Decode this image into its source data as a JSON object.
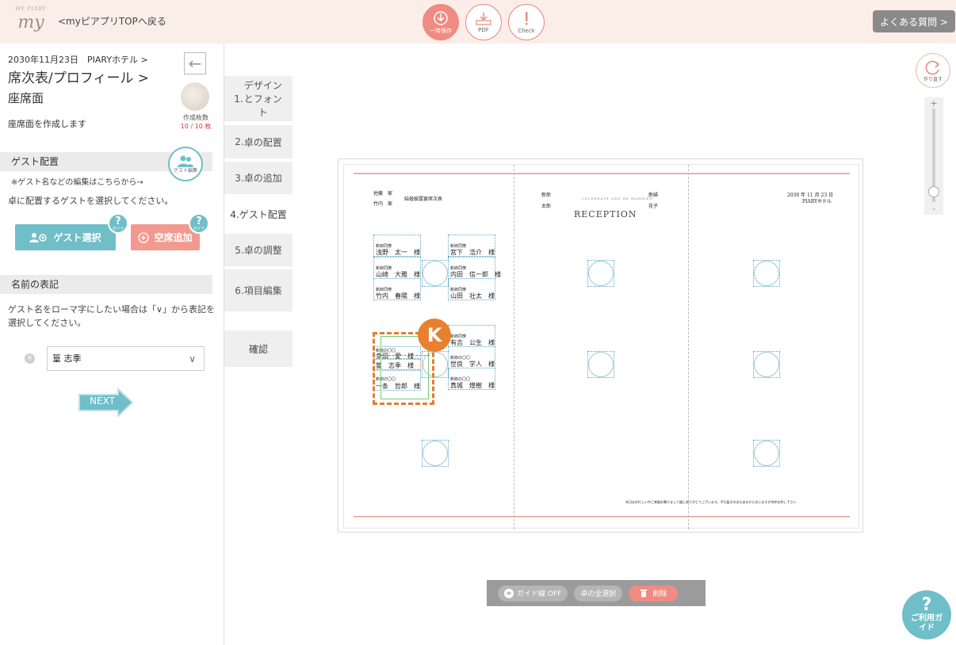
{
  "header": {
    "logo_text": "my",
    "logo_small": "MY PIARY",
    "back_link": "<myピアプリTOPへ戻る",
    "tools": [
      {
        "label": "一時保存",
        "icon": "download-icon"
      },
      {
        "label": "PDF",
        "icon": "pdf-icon"
      },
      {
        "label": "Check",
        "icon": "check-icon"
      }
    ],
    "faq": "よくある質問 >"
  },
  "sidebar": {
    "breadcrumb": "2030年11月23日　PIARYホテル >",
    "title1": "席次表/プロフィール >",
    "title2": "座席面",
    "description": "座席面を作成します",
    "count_label": "作成枚数",
    "count_value": "10 / 10 枚",
    "guest_section": "ゲスト配置",
    "guest_edit_label": "ゲスト編集",
    "guest_note": "※ゲスト名などの編集はこちらから→",
    "guest_instruction": "卓に配置するゲストを選択してください。",
    "guest_select_btn": "ゲスト選択",
    "empty_seat_btn": "空席追加",
    "guide_label": "ガイド",
    "name_section": "名前の表記",
    "name_instruction": "ゲスト名をローマ字にしたい場合は「∨」から表記を選択してください。",
    "name_value": "篁 志季",
    "next_btn": "NEXT"
  },
  "steps": [
    {
      "num": "1.",
      "label": "デザインとフォント"
    },
    {
      "num": "2.",
      "label": "卓の配置"
    },
    {
      "num": "3.",
      "label": "卓の追加"
    },
    {
      "num": "4.",
      "label": "ゲスト配置"
    },
    {
      "num": "5.",
      "label": "卓の調整"
    },
    {
      "num": "6.",
      "label": "項目編集"
    }
  ],
  "confirm": "確認",
  "canvas": {
    "family_left1": "佐藤　家",
    "family_left2": "竹内　家",
    "event_title": "結婚披露宴席次表",
    "groom_label": "新郎",
    "groom_name": "太郎",
    "bride_label": "新婦",
    "bride_name": "花子",
    "arc_text": "CELEBRATE AND BE MARRIED",
    "reception": "RECEPTION",
    "date": "2030 年 11 月 23 日",
    "venue": "PIARYホテル",
    "footer_note": "本日はお忙しい中ご来臨を賜りまして誠にありがとうございます。不行届きの点もあるかと存じますが何卒お許し下さい",
    "badge": "K",
    "seats": [
      {
        "title": "新郎同僚",
        "name": "浅野　太一　様"
      },
      {
        "title": "新郎同僚",
        "name": "山崎　大雅　様"
      },
      {
        "title": "新郎同僚",
        "name": "竹内　春陽　様"
      },
      {
        "title": "新郎同僚",
        "name": "宮下　浩介　様"
      },
      {
        "title": "新郎同僚",
        "name": "内田　信一郎　様"
      },
      {
        "title": "新郎同僚",
        "name": "山田　壮太　様"
      },
      {
        "title": "新郎同僚",
        "name": "有吉　公生　様"
      },
      {
        "title": "新郎の〇〇",
        "name": "世良　学人　様"
      },
      {
        "title": "新郎の〇〇",
        "name": "真城　煌樹　様"
      },
      {
        "title": "新郎の〇〇",
        "name": "幸田　愛　様"
      },
      {
        "title": "新郎の〇〇",
        "name": "篁　志季　様"
      },
      {
        "title": "新郎の〇〇",
        "name": "一条　哲郎　様"
      }
    ]
  },
  "right": {
    "redo_label": "作り直す",
    "zoom_plus": "+",
    "zoom_minus": "-",
    "zoom_level": 0.1
  },
  "bottom": {
    "guide_line": "ガイド線 OFF",
    "select_all": "卓の全選択",
    "delete": "削除"
  },
  "guide_fab": {
    "q": "?",
    "label": "ご利用ガイド"
  },
  "colors": {
    "accent_teal": "#6fbec8",
    "accent_coral": "#f08b82",
    "selection_orange": "#e8802f",
    "header_bg": "#fbeee9"
  }
}
